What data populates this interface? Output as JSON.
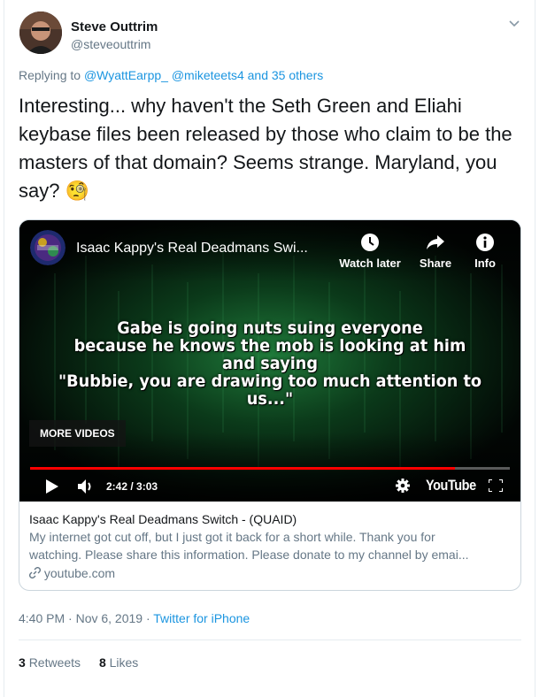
{
  "author": {
    "name": "Steve Outtrim",
    "handle": "@steveouttrim"
  },
  "reply": {
    "prefix": "Replying to",
    "mentions": "@WyattEarpp_ @miketeets4 and 35 others"
  },
  "tweet": {
    "text": "Interesting... why haven't the Seth Green and Eliahi keybase files been released by those who claim to be the masters of that domain? Seems strange. Maryland, you say? 🧐",
    "emoji": "🧐"
  },
  "video": {
    "title": "Isaac Kappy's Real Deadmans Swi...",
    "buttons": {
      "watch_later": "Watch later",
      "share": "Share",
      "info": "Info"
    },
    "overlay_lines": [
      "Gabe is going nuts suing everyone",
      "because he knows the mob is looking at him",
      "and saying",
      "\"Bubbie, you are drawing too much attention to us...\""
    ],
    "more_videos": "MORE VIDEOS",
    "time": "2:42 / 3:03",
    "progress": 0.885,
    "platform_logo": "YouTube",
    "icons": [
      "play-icon",
      "volume-icon",
      "settings-gear-icon",
      "fullscreen-icon",
      "clock-icon",
      "share-arrow-icon",
      "info-icon"
    ]
  },
  "card": {
    "title": "Isaac Kappy's Real Deadmans Switch - (QUAID)",
    "description_line1": "My internet got cut off, but I just got it back for a short while. Thank you for",
    "description_line2": "watching. Please share this information. Please donate to my channel by emai...",
    "domain": "youtube.com"
  },
  "meta": {
    "time": "4:40 PM · Nov 6, 2019 · ",
    "source": "Twitter for iPhone"
  },
  "stats": {
    "retweets_count": "3",
    "retweets_label": "Retweets",
    "likes_count": "8",
    "likes_label": "Likes"
  },
  "colors": {
    "link": "#1b95e0",
    "secondary_text": "#657786",
    "progress": "#ff0000",
    "border": "#ccd6dd"
  }
}
